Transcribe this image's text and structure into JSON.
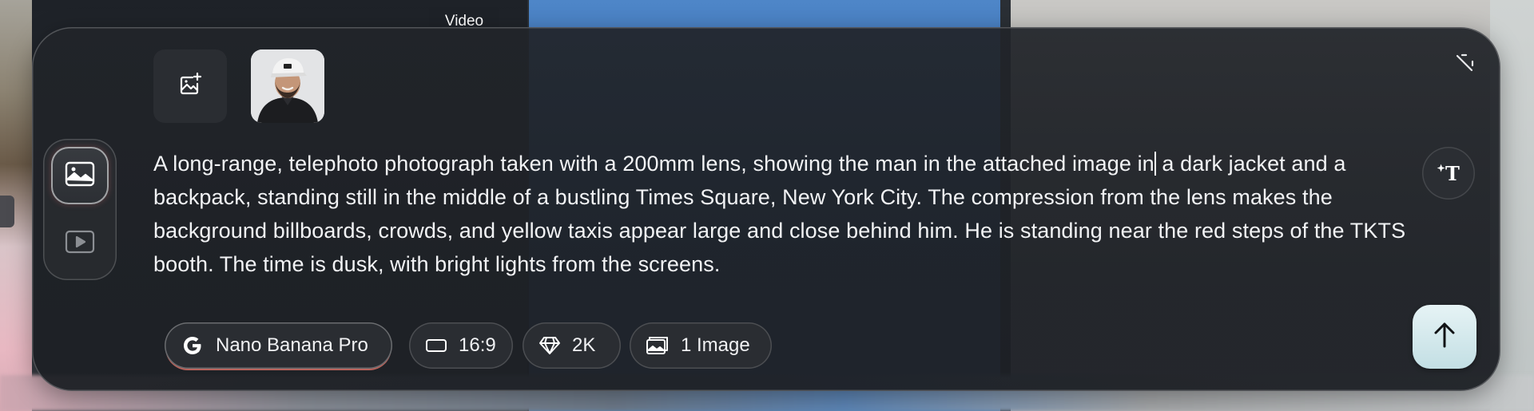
{
  "background": {
    "video_chip_label": "Video"
  },
  "composer": {
    "attachments": {
      "add_button_icon": "image-add-icon",
      "thumbnail_icon": "person-photo"
    },
    "collapse_icon": "collapse-icon",
    "mode_toggle": {
      "image_icon": "image-icon",
      "video_icon": "video-play-icon",
      "active": "image"
    },
    "prompt": {
      "text_before_caret": "A long-range, telephoto photograph taken with a 200mm lens, showing the man in the attached image in",
      "text_after_caret": " a dark jacket and a backpack, standing still in the middle of a bustling Times Square, New York City. The compression from the lens makes the background billboards, crowds, and yellow taxis appear large and close behind him. He is standing near the red steps of the TKTS booth. The time is dusk, with bright lights from the screens."
    },
    "text_style_icon": "text-sparkle-icon",
    "options": {
      "model": {
        "label": "Nano Banana Pro",
        "icon": "google-g-icon"
      },
      "aspect_ratio": {
        "label": "16:9",
        "icon": "rectangle-icon"
      },
      "quality": {
        "label": "2K",
        "icon": "diamond-icon"
      },
      "image_count": {
        "label": "1 Image",
        "icon": "images-icon"
      }
    },
    "send_icon": "arrow-up-icon"
  },
  "colors": {
    "panel": "#212429",
    "text": "#f2f3f5",
    "send_button": "#d4e9ed",
    "model_accent": "#eb786e"
  }
}
